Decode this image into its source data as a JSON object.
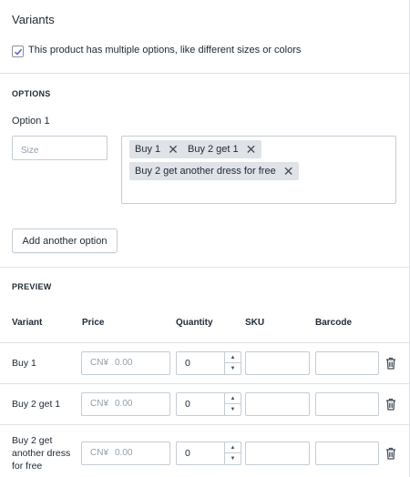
{
  "variants_section": {
    "title": "Variants",
    "multiple_options_checked": true,
    "multiple_options_label": "This product has multiple options, like different sizes or colors"
  },
  "options_section": {
    "heading": "OPTIONS",
    "option1_label": "Option 1",
    "option_name_placeholder": "Size",
    "tags": [
      "Buy 1",
      "Buy 2 get 1",
      "Buy 2 get another dress for free"
    ],
    "add_another_option_label": "Add another option"
  },
  "preview_section": {
    "heading": "PREVIEW",
    "columns": [
      "Variant",
      "Price",
      "Quantity",
      "SKU",
      "Barcode"
    ],
    "rows": [
      {
        "variant_lines": [
          "Buy 1"
        ],
        "currency": "CN¥",
        "price_placeholder": "0.00",
        "quantity": "0",
        "sku": "",
        "barcode": ""
      },
      {
        "variant_lines": [
          "Buy 2 get 1"
        ],
        "currency": "CN¥",
        "price_placeholder": "0.00",
        "quantity": "0",
        "sku": "",
        "barcode": ""
      },
      {
        "variant_lines": [
          "Buy 2 get",
          "another dress",
          "for free"
        ],
        "currency": "CN¥",
        "price_placeholder": "0.00",
        "quantity": "0",
        "sku": "",
        "barcode": ""
      }
    ]
  },
  "icons": {
    "checkbox": "checkmark-icon",
    "tag_remove": "close-icon",
    "stepper_up": "chevron-up-icon",
    "stepper_down": "chevron-down-icon",
    "delete": "trash-icon"
  },
  "colors": {
    "accent": "#5c6ac4",
    "border": "#c4cdd5",
    "divider": "#dfe3e8",
    "tag_bg": "#dfe3e8",
    "text": "#212b36",
    "placeholder": "#919eab"
  }
}
